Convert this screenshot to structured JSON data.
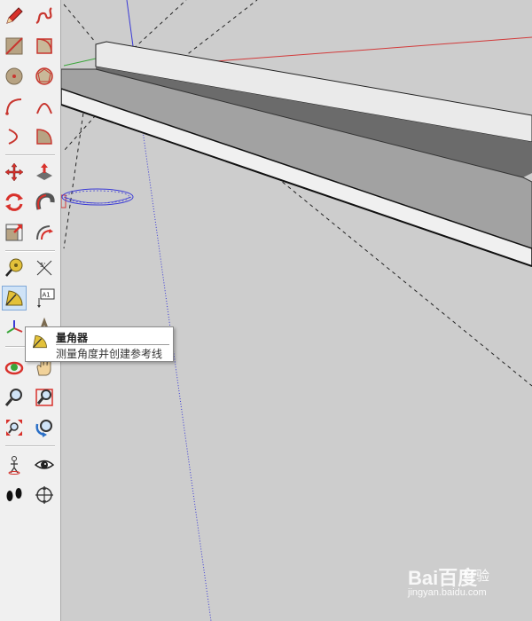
{
  "toolbar": {
    "tools": [
      {
        "name": "pencil-icon"
      },
      {
        "name": "freehand-icon"
      },
      {
        "name": "rectangle-icon"
      },
      {
        "name": "rotated-rectangle-icon"
      },
      {
        "name": "circle-icon"
      },
      {
        "name": "polygon-icon"
      },
      {
        "name": "arc-icon"
      },
      {
        "name": "two-point-arc-icon"
      },
      {
        "name": "three-point-arc-icon"
      },
      {
        "name": "pie-icon"
      },
      {
        "name": "move-icon"
      },
      {
        "name": "push-pull-icon"
      },
      {
        "name": "rotate-icon"
      },
      {
        "name": "follow-me-icon"
      },
      {
        "name": "scale-icon"
      },
      {
        "name": "offset-icon"
      },
      {
        "name": "tape-measure-icon"
      },
      {
        "name": "dimension-icon"
      },
      {
        "name": "protractor-icon"
      },
      {
        "name": "text-icon"
      },
      {
        "name": "axes-icon"
      },
      {
        "name": "3d-text-icon"
      },
      {
        "name": "orbit-icon"
      },
      {
        "name": "pan-icon"
      },
      {
        "name": "zoom-icon"
      },
      {
        "name": "zoom-window-icon"
      },
      {
        "name": "zoom-extents-icon"
      },
      {
        "name": "previous-view-icon"
      },
      {
        "name": "position-camera-icon"
      },
      {
        "name": "look-around-icon"
      },
      {
        "name": "walk-icon"
      },
      {
        "name": "section-plane-icon"
      }
    ],
    "text_tool_label": "A1",
    "active_tool": "protractor-icon"
  },
  "tooltip": {
    "title": "量角器",
    "description": "测量角度并创建参考线"
  },
  "colors": {
    "toolbar_bg": "#f0f0f0",
    "viewport_bg": "#cdcdcd",
    "axis_red": "#d23a3a",
    "axis_green": "#3aa63a",
    "axis_blue": "#3a3ad6",
    "active_tool_bg": "#cfe3f7"
  },
  "watermark": {
    "logo": "Bai百度",
    "text": "经验",
    "url": "jingyan.baidu.com"
  }
}
